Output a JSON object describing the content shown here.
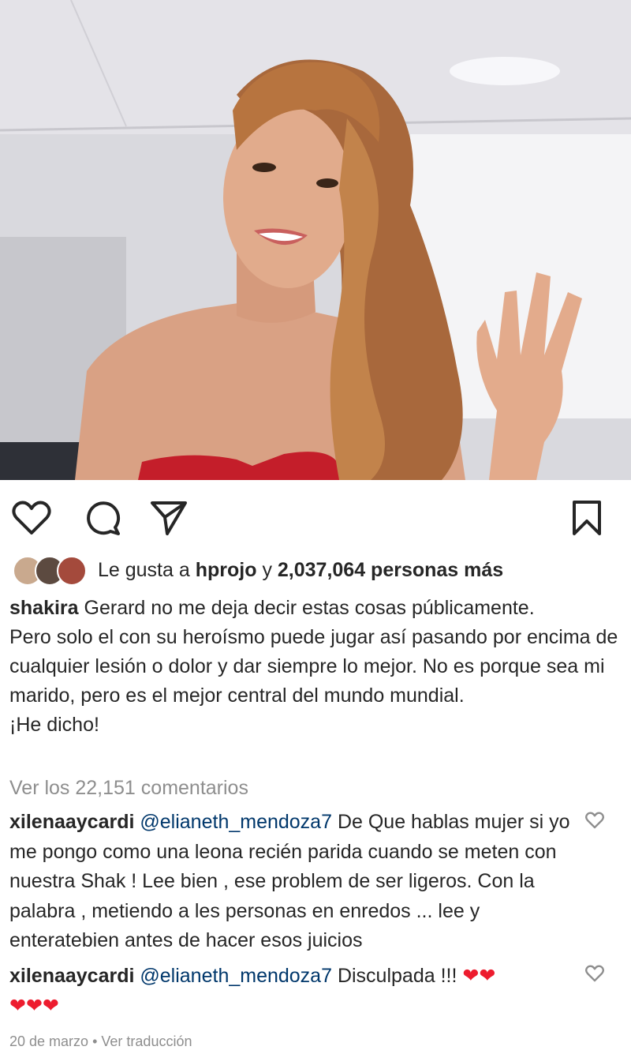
{
  "post": {
    "photo_alt": "Shakira selfie"
  },
  "actions": {
    "like": "heart-icon",
    "comment": "comment-icon",
    "share": "send-icon",
    "save": "bookmark-icon"
  },
  "likes": {
    "prefix": "Le gusta a",
    "user": "hprojo",
    "joiner": "y",
    "count": "2,037,064 personas más"
  },
  "caption": {
    "username": "shakira",
    "line1": "Gerard no me deja decir estas cosas públicamente.",
    "body": "Pero solo el con su heroísmo puede jugar así pasando por encima de cualquier lesión o dolor y dar siempre lo mejor. No es porque sea mi marido, pero es el mejor central del mundo mundial.",
    "line_last": "¡He dicho!"
  },
  "view_comments": "Ver los 22,151 comentarios",
  "comments": [
    {
      "username": "xilenaaycardi",
      "mention": "@elianeth_mendoza7",
      "text": "De Que hablas mujer si yo me pongo como una leona recién parida cuando se meten con nuestra Shak ! Lee bien , ese problem de ser ligeros. Con la palabra , metiendo a les personas en enredos ... lee y enteratebien antes de hacer esos juicios"
    },
    {
      "username": "xilenaaycardi",
      "mention": "@elianeth_mendoza7",
      "text": "Disculpada !!!",
      "hearts_inline": "❤❤",
      "hearts_next": "❤❤❤"
    }
  ],
  "meta": {
    "date": "20 de marzo",
    "separator": "•",
    "translate": "Ver traducción"
  },
  "colors": {
    "text": "#262626",
    "muted": "#8e8e8e",
    "mention": "#00376b",
    "heart": "#ed1c2e"
  }
}
